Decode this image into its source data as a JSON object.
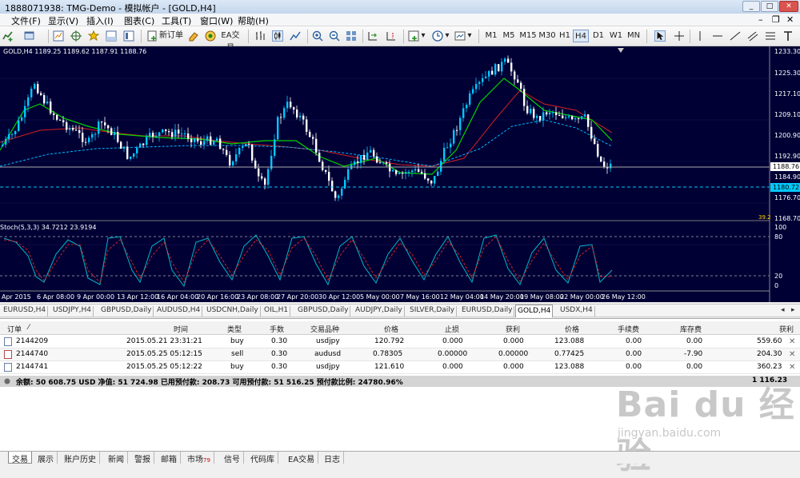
{
  "window": {
    "title": "1888071938: TMG-Demo - 模拟帐户 - [GOLD,H4]"
  },
  "menu": [
    "文件(F)",
    "显示(V)",
    "插入(I)",
    "图表(C)",
    "工具(T)",
    "窗口(W)",
    "帮助(H)"
  ],
  "toolbar": {
    "new_order": "新订单",
    "ea_trade": "EA交易",
    "timeframes": [
      "M1",
      "M5",
      "M15",
      "M30",
      "H1",
      "H4",
      "D1",
      "W1",
      "MN"
    ],
    "active_tf": "H4"
  },
  "chart": {
    "header": "GOLD,H4  1189.25 1189.62 1187.91 1188.76",
    "price_labels": [
      "1233.30",
      "1225.30",
      "1217.10",
      "1209.10",
      "1200.90",
      "1192.90",
      "1184.90",
      "1176.70",
      "1168.70"
    ],
    "current_price": "1188.76",
    "bid_line": "1180.72",
    "stoch_header": "Stoch(5,3,3) 34.7212 23.9194",
    "stoch_labels": [
      "100",
      "80",
      "20",
      "0"
    ],
    "small_label": "39.2",
    "time_labels": [
      "Apr 2015",
      "6 Apr 08:00",
      "9 Apr 00:00",
      "13 Apr 12:00",
      "16 Apr 04:00",
      "20 Apr 16:00",
      "23 Apr 08:00",
      "27 Apr 20:00",
      "30 Apr 12:00",
      "5 May 00:00",
      "7 May 16:00",
      "12 May 04:00",
      "14 May 20:00",
      "19 May 08:00",
      "22 May 00:00",
      "26 May 12:00"
    ],
    "colors": {
      "bg": "#000035",
      "candle": "#ffffff",
      "bull": "#00c9ff",
      "ma_fast": "#00d400",
      "ma_slow": "#d42020",
      "ma_dashed": "#00b8ff"
    }
  },
  "chart_tabs": [
    "EURUSD,H4",
    "USDJPY,H4",
    "GBPUSD,Daily",
    "AUDUSD,H4",
    "USDCNH,Daily",
    "OIL,H1",
    "GBPUSD,Daily",
    "AUDJPY,Daily",
    "SILVER,Daily",
    "EURUSD,Daily",
    "GOLD,H4",
    "USDX,H4"
  ],
  "active_chart_tab": "GOLD,H4",
  "orders": {
    "headers": [
      "订单",
      "时间",
      "类型",
      "手数",
      "交易品种",
      "价格",
      "止损",
      "获利",
      "价格",
      "手续费",
      "库存费",
      "获利"
    ],
    "rows": [
      {
        "ticket": "2144209",
        "time": "2015.05.21 23:31:21",
        "type": "buy",
        "lots": "0.30",
        "symbol": "usdjpy",
        "price": "120.792",
        "sl": "0.000",
        "tp": "0.000",
        "cur": "123.088",
        "commission": "0.00",
        "swap": "0.00",
        "profit": "559.60"
      },
      {
        "ticket": "2144740",
        "time": "2015.05.25 05:12:15",
        "type": "sell",
        "lots": "0.30",
        "symbol": "audusd",
        "price": "0.78305",
        "sl": "0.00000",
        "tp": "0.00000",
        "cur": "0.77425",
        "commission": "0.00",
        "swap": "-7.90",
        "profit": "204.30"
      },
      {
        "ticket": "2144741",
        "time": "2015.05.25 05:12:22",
        "type": "buy",
        "lots": "0.30",
        "symbol": "usdjpy",
        "price": "121.610",
        "sl": "0.000",
        "tp": "0.000",
        "cur": "123.088",
        "commission": "0.00",
        "swap": "0.00",
        "profit": "360.23"
      }
    ],
    "balance_text": "余额: 50 608.75 USD  净值: 51 724.98  已用预付款: 208.73  可用预付款: 51 516.25  预付款比例: 24780.96%",
    "total_profit": "1 116.23"
  },
  "terminal_tabs": [
    {
      "label": "交易"
    },
    {
      "label": "展示"
    },
    {
      "label": "账户历史"
    },
    {
      "label": "新闻"
    },
    {
      "label": "警报"
    },
    {
      "label": "邮箱"
    },
    {
      "label": "市场",
      "badge": "79"
    },
    {
      "label": "信号"
    },
    {
      "label": "代码库"
    },
    {
      "label": "EA交易"
    },
    {
      "label": "日志"
    }
  ],
  "watermark": {
    "main": "Bai du 经验",
    "sub": "jingyan.baidu.com"
  }
}
